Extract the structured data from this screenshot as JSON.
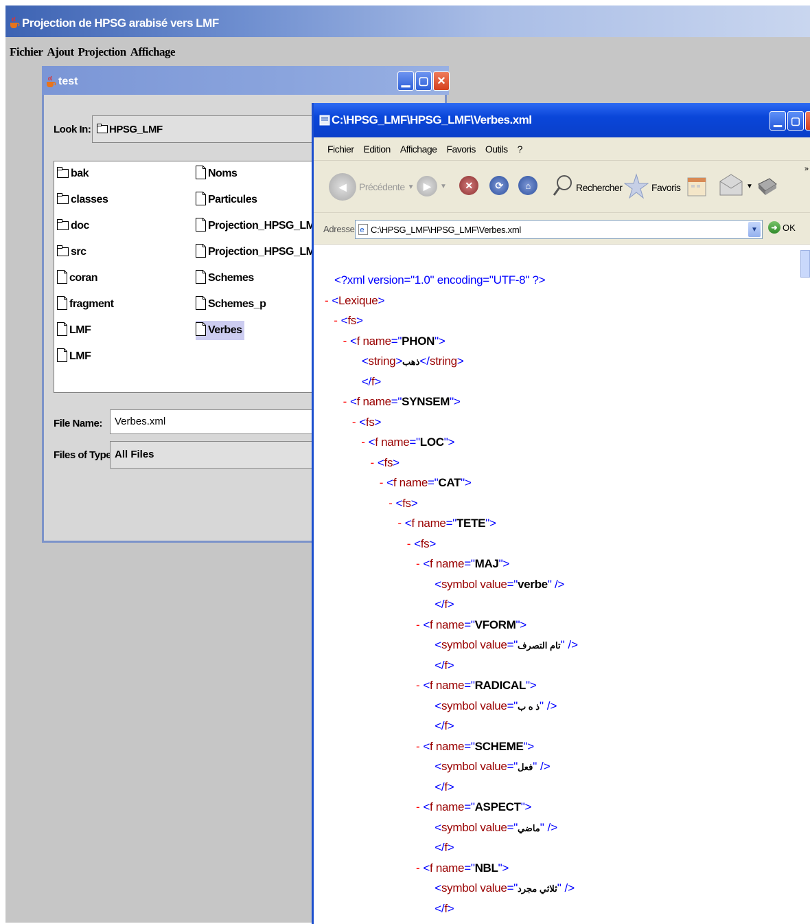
{
  "app": {
    "title": "Projection de HPSG arabisé vers LMF",
    "menu": [
      "Fichier",
      "Ajout",
      "Projection",
      "Affichage"
    ]
  },
  "test_frame": {
    "title": "test",
    "look_in_label": "Look In:",
    "look_in_value": "HPSG_LMF",
    "files_col1": [
      {
        "name": "bak",
        "type": "folder"
      },
      {
        "name": "classes",
        "type": "folder"
      },
      {
        "name": "doc",
        "type": "folder"
      },
      {
        "name": "src",
        "type": "folder"
      },
      {
        "name": "coran",
        "type": "file"
      },
      {
        "name": "fragment",
        "type": "file"
      },
      {
        "name": "LMF",
        "type": "file"
      },
      {
        "name": "LMF",
        "type": "file"
      }
    ],
    "files_col2": [
      {
        "name": "Noms",
        "type": "file"
      },
      {
        "name": "Particules",
        "type": "file"
      },
      {
        "name": "Projection_HPSG_LMF",
        "type": "file"
      },
      {
        "name": "Projection_HPSG_LMF.jpx.",
        "type": "file"
      },
      {
        "name": "Schemes",
        "type": "file"
      },
      {
        "name": "Schemes_p",
        "type": "file"
      },
      {
        "name": "Verbes",
        "type": "file",
        "selected": true
      }
    ],
    "file_name_label": "File Name:",
    "file_name_value": "Verbes.xml",
    "files_type_label": "Files of Type:",
    "files_type_value": "All Files"
  },
  "ie": {
    "title": "C:\\HPSG_LMF\\HPSG_LMF\\Verbes.xml",
    "menu": [
      "Fichier",
      "Edition",
      "Affichage",
      "Favoris",
      "Outils",
      "?"
    ],
    "back_label": "Précédente",
    "search_label": "Rechercher",
    "favorites_label": "Favoris",
    "address_label": "Adresse",
    "address_value": "C:\\HPSG_LMF\\HPSG_LMF\\Verbes.xml",
    "go_label": "OK",
    "xml_lines": [
      {
        "indent": 0,
        "dash": false,
        "parts": [
          [
            "pi",
            "<?xml version=\"1.0\" encoding=\"UTF-8\" ?>"
          ]
        ]
      },
      {
        "indent": 0,
        "dash": true,
        "parts": [
          [
            "blue",
            "<"
          ],
          [
            "attr",
            "Lexique"
          ],
          [
            "blue",
            ">"
          ]
        ]
      },
      {
        "indent": 1,
        "dash": true,
        "parts": [
          [
            "blue",
            "<"
          ],
          [
            "attr",
            "fs"
          ],
          [
            "blue",
            ">"
          ]
        ]
      },
      {
        "indent": 2,
        "dash": true,
        "parts": [
          [
            "blue",
            "<"
          ],
          [
            "attr",
            "f"
          ],
          [
            "attr",
            " name"
          ],
          [
            "blue",
            "=\""
          ],
          [
            "val",
            "PHON"
          ],
          [
            "blue",
            "\">"
          ]
        ]
      },
      {
        "indent": 3,
        "dash": false,
        "parts": [
          [
            "blue",
            "<"
          ],
          [
            "attr",
            "string"
          ],
          [
            "blue",
            ">"
          ],
          [
            "val",
            "ذهب"
          ],
          [
            "blue",
            "</"
          ],
          [
            "attr",
            "string"
          ],
          [
            "blue",
            ">"
          ]
        ]
      },
      {
        "indent": 3,
        "dash": false,
        "parts": [
          [
            "blue",
            "</"
          ],
          [
            "attr",
            "f"
          ],
          [
            "blue",
            ">"
          ]
        ]
      },
      {
        "indent": 2,
        "dash": true,
        "parts": [
          [
            "blue",
            "<"
          ],
          [
            "attr",
            "f"
          ],
          [
            "attr",
            " name"
          ],
          [
            "blue",
            "=\""
          ],
          [
            "val",
            "SYNSEM"
          ],
          [
            "blue",
            "\">"
          ]
        ]
      },
      {
        "indent": 3,
        "dash": true,
        "parts": [
          [
            "blue",
            "<"
          ],
          [
            "attr",
            "fs"
          ],
          [
            "blue",
            ">"
          ]
        ]
      },
      {
        "indent": 4,
        "dash": true,
        "parts": [
          [
            "blue",
            "<"
          ],
          [
            "attr",
            "f"
          ],
          [
            "attr",
            " name"
          ],
          [
            "blue",
            "=\""
          ],
          [
            "val",
            "LOC"
          ],
          [
            "blue",
            "\">"
          ]
        ]
      },
      {
        "indent": 5,
        "dash": true,
        "parts": [
          [
            "blue",
            "<"
          ],
          [
            "attr",
            "fs"
          ],
          [
            "blue",
            ">"
          ]
        ]
      },
      {
        "indent": 6,
        "dash": true,
        "parts": [
          [
            "blue",
            "<"
          ],
          [
            "attr",
            "f"
          ],
          [
            "attr",
            " name"
          ],
          [
            "blue",
            "=\""
          ],
          [
            "val",
            "CAT"
          ],
          [
            "blue",
            "\">"
          ]
        ]
      },
      {
        "indent": 7,
        "dash": true,
        "parts": [
          [
            "blue",
            "<"
          ],
          [
            "attr",
            "fs"
          ],
          [
            "blue",
            ">"
          ]
        ]
      },
      {
        "indent": 8,
        "dash": true,
        "parts": [
          [
            "blue",
            "<"
          ],
          [
            "attr",
            "f"
          ],
          [
            "attr",
            " name"
          ],
          [
            "blue",
            "=\""
          ],
          [
            "val",
            "TETE"
          ],
          [
            "blue",
            "\">"
          ]
        ]
      },
      {
        "indent": 9,
        "dash": true,
        "parts": [
          [
            "blue",
            "<"
          ],
          [
            "attr",
            "fs"
          ],
          [
            "blue",
            ">"
          ]
        ]
      },
      {
        "indent": 10,
        "dash": true,
        "parts": [
          [
            "blue",
            "<"
          ],
          [
            "attr",
            "f"
          ],
          [
            "attr",
            " name"
          ],
          [
            "blue",
            "=\""
          ],
          [
            "val",
            "MAJ"
          ],
          [
            "blue",
            "\">"
          ]
        ]
      },
      {
        "indent": 11,
        "dash": false,
        "parts": [
          [
            "blue",
            "<"
          ],
          [
            "attr",
            "symbol"
          ],
          [
            "attr",
            " value"
          ],
          [
            "blue",
            "=\""
          ],
          [
            "val",
            "verbe"
          ],
          [
            "blue",
            "\" />"
          ]
        ]
      },
      {
        "indent": 11,
        "dash": false,
        "parts": [
          [
            "blue",
            "</"
          ],
          [
            "attr",
            "f"
          ],
          [
            "blue",
            ">"
          ]
        ]
      },
      {
        "indent": 10,
        "dash": true,
        "parts": [
          [
            "blue",
            "<"
          ],
          [
            "attr",
            "f"
          ],
          [
            "attr",
            " name"
          ],
          [
            "blue",
            "=\""
          ],
          [
            "val",
            "VFORM"
          ],
          [
            "blue",
            "\">"
          ]
        ]
      },
      {
        "indent": 11,
        "dash": false,
        "parts": [
          [
            "blue",
            "<"
          ],
          [
            "attr",
            "symbol"
          ],
          [
            "attr",
            " value"
          ],
          [
            "blue",
            "=\""
          ],
          [
            "val",
            "تام التصرف"
          ],
          [
            "blue",
            "\" />"
          ]
        ]
      },
      {
        "indent": 11,
        "dash": false,
        "parts": [
          [
            "blue",
            "</"
          ],
          [
            "attr",
            "f"
          ],
          [
            "blue",
            ">"
          ]
        ]
      },
      {
        "indent": 10,
        "dash": true,
        "parts": [
          [
            "blue",
            "<"
          ],
          [
            "attr",
            "f"
          ],
          [
            "attr",
            " name"
          ],
          [
            "blue",
            "=\""
          ],
          [
            "val",
            "RADICAL"
          ],
          [
            "blue",
            "\">"
          ]
        ]
      },
      {
        "indent": 11,
        "dash": false,
        "parts": [
          [
            "blue",
            "<"
          ],
          [
            "attr",
            "symbol"
          ],
          [
            "attr",
            " value"
          ],
          [
            "blue",
            "=\""
          ],
          [
            "val",
            "ذ ه ب"
          ],
          [
            "blue",
            "\" />"
          ]
        ]
      },
      {
        "indent": 11,
        "dash": false,
        "parts": [
          [
            "blue",
            "</"
          ],
          [
            "attr",
            "f"
          ],
          [
            "blue",
            ">"
          ]
        ]
      },
      {
        "indent": 10,
        "dash": true,
        "parts": [
          [
            "blue",
            "<"
          ],
          [
            "attr",
            "f"
          ],
          [
            "attr",
            " name"
          ],
          [
            "blue",
            "=\""
          ],
          [
            "val",
            "SCHEME"
          ],
          [
            "blue",
            "\">"
          ]
        ]
      },
      {
        "indent": 11,
        "dash": false,
        "parts": [
          [
            "blue",
            "<"
          ],
          [
            "attr",
            "symbol"
          ],
          [
            "attr",
            " value"
          ],
          [
            "blue",
            "=\""
          ],
          [
            "val",
            "فعل"
          ],
          [
            "blue",
            "\" />"
          ]
        ]
      },
      {
        "indent": 11,
        "dash": false,
        "parts": [
          [
            "blue",
            "</"
          ],
          [
            "attr",
            "f"
          ],
          [
            "blue",
            ">"
          ]
        ]
      },
      {
        "indent": 10,
        "dash": true,
        "parts": [
          [
            "blue",
            "<"
          ],
          [
            "attr",
            "f"
          ],
          [
            "attr",
            " name"
          ],
          [
            "blue",
            "=\""
          ],
          [
            "val",
            "ASPECT"
          ],
          [
            "blue",
            "\">"
          ]
        ]
      },
      {
        "indent": 11,
        "dash": false,
        "parts": [
          [
            "blue",
            "<"
          ],
          [
            "attr",
            "symbol"
          ],
          [
            "attr",
            " value"
          ],
          [
            "blue",
            "=\""
          ],
          [
            "val",
            "ماضي"
          ],
          [
            "blue",
            "\" />"
          ]
        ]
      },
      {
        "indent": 11,
        "dash": false,
        "parts": [
          [
            "blue",
            "</"
          ],
          [
            "attr",
            "f"
          ],
          [
            "blue",
            ">"
          ]
        ]
      },
      {
        "indent": 10,
        "dash": true,
        "parts": [
          [
            "blue",
            "<"
          ],
          [
            "attr",
            "f"
          ],
          [
            "attr",
            " name"
          ],
          [
            "blue",
            "=\""
          ],
          [
            "val",
            "NBL"
          ],
          [
            "blue",
            "\">"
          ]
        ]
      },
      {
        "indent": 11,
        "dash": false,
        "parts": [
          [
            "blue",
            "<"
          ],
          [
            "attr",
            "symbol"
          ],
          [
            "attr",
            " value"
          ],
          [
            "blue",
            "=\""
          ],
          [
            "val",
            "ثلاثي مجرد"
          ],
          [
            "blue",
            "\" />"
          ]
        ]
      },
      {
        "indent": 11,
        "dash": false,
        "parts": [
          [
            "blue",
            "</"
          ],
          [
            "attr",
            "f"
          ],
          [
            "blue",
            ">"
          ]
        ]
      }
    ]
  },
  "colors": {
    "xp_title_blue": "#0a46d9",
    "xml_tag_blue": "#0000ff",
    "xml_name_red": "#990000",
    "xml_dash_red": "#ff0000",
    "selection": "#ccccf0"
  }
}
